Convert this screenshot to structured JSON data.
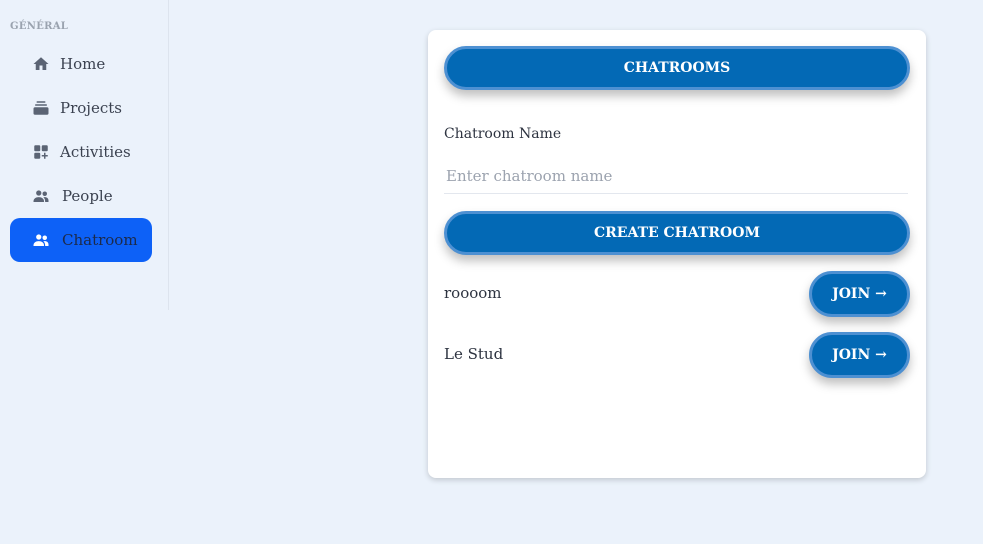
{
  "sidebar": {
    "section_label": "GÉNÉRAL",
    "items": [
      {
        "label": "Home",
        "icon": "home-icon"
      },
      {
        "label": "Projects",
        "icon": "projects-icon"
      },
      {
        "label": "Activities",
        "icon": "activities-icon"
      },
      {
        "label": "People",
        "icon": "people-icon"
      },
      {
        "label": "Chatroom",
        "icon": "chatroom-icon",
        "active": true
      }
    ]
  },
  "card": {
    "header_label": "CHATROOMS",
    "field_label": "Chatroom Name",
    "input": {
      "value": "",
      "placeholder": "Enter chatroom name"
    },
    "create_label": "CREATE CHATROOM",
    "rooms": [
      {
        "name": "roooom",
        "join_label": "JOIN →"
      },
      {
        "name": "Le Stud",
        "join_label": "JOIN →"
      }
    ]
  },
  "colors": {
    "background": "#ebf2fb",
    "active_nav": "#0d61f7",
    "button": "#0369b5",
    "button_border": "#4d90d2"
  }
}
